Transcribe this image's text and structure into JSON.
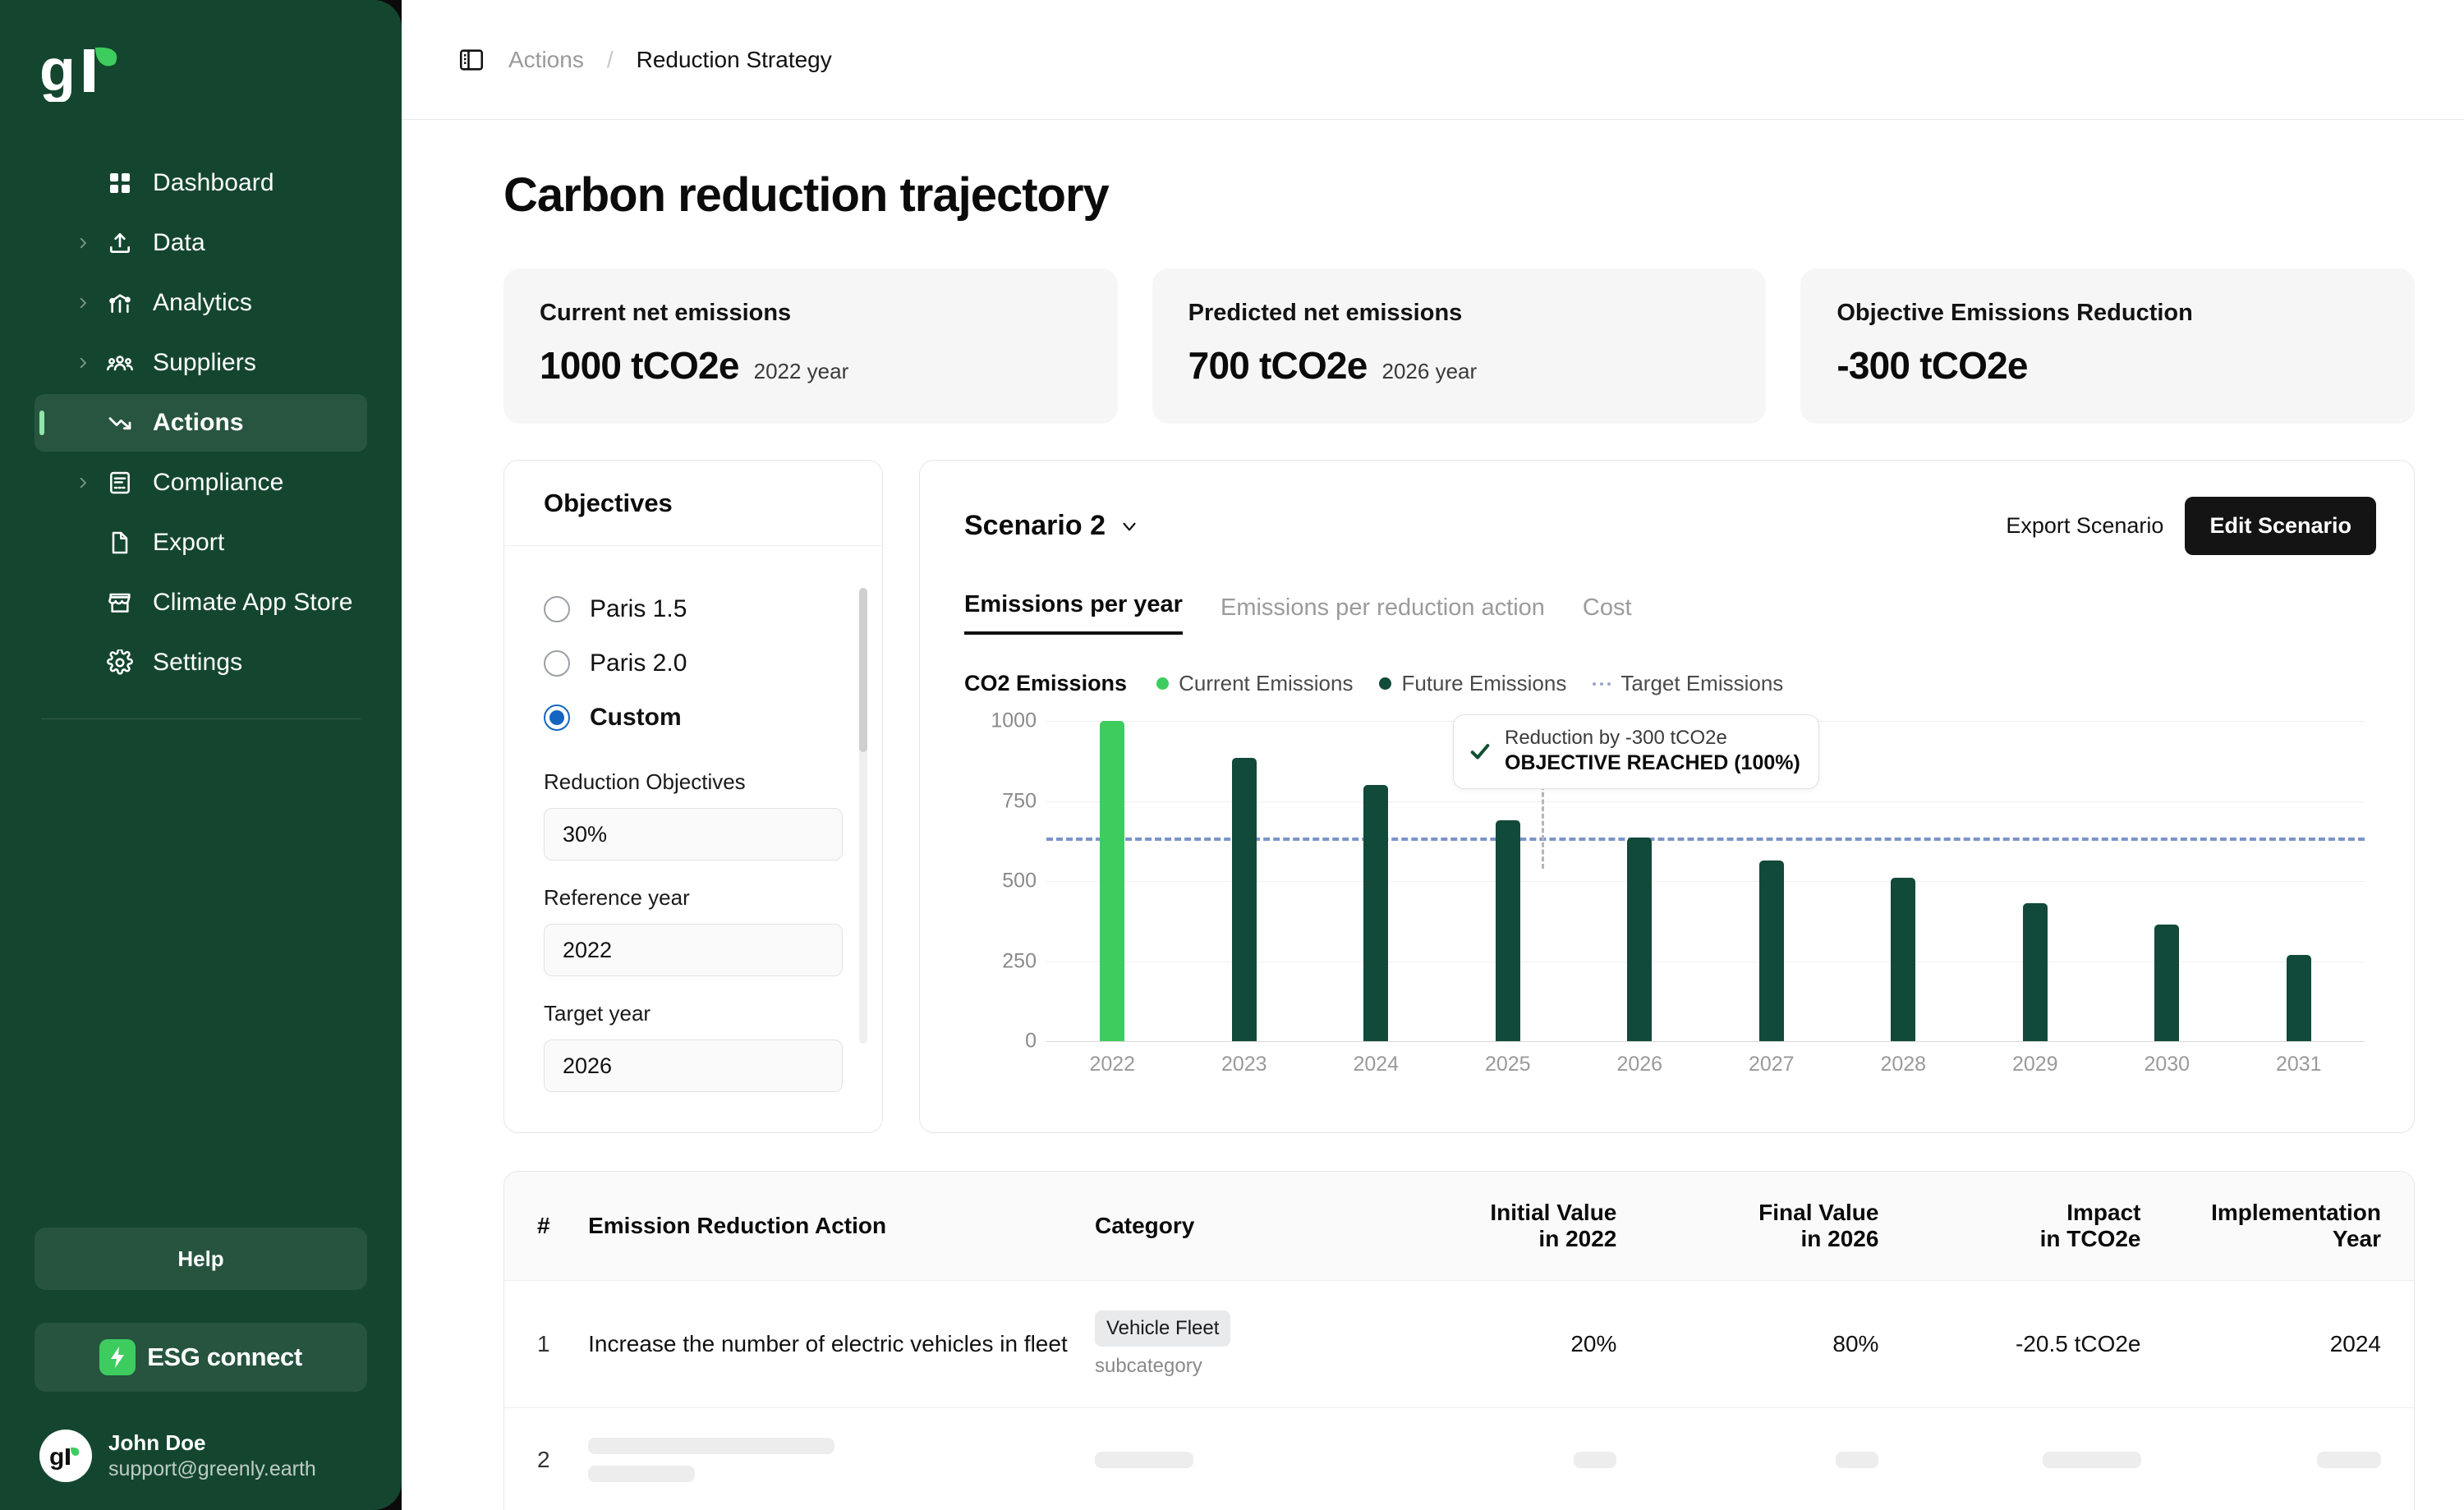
{
  "brand": {
    "logo_text": "gr",
    "accent": "#3ECC5F",
    "sidebar_bg": "#14462F",
    "dark_green": "#11493B"
  },
  "sidebar": {
    "items": [
      {
        "label": "Dashboard",
        "icon": "grid-icon",
        "expandable": false,
        "active": false
      },
      {
        "label": "Data",
        "icon": "upload-icon",
        "expandable": true,
        "active": false
      },
      {
        "label": "Analytics",
        "icon": "analytics-icon",
        "expandable": true,
        "active": false
      },
      {
        "label": "Suppliers",
        "icon": "people-icon",
        "expandable": true,
        "active": false
      },
      {
        "label": "Actions",
        "icon": "trend-down-icon",
        "expandable": false,
        "active": true
      },
      {
        "label": "Compliance",
        "icon": "document-list-icon",
        "expandable": true,
        "active": false
      },
      {
        "label": "Export",
        "icon": "file-icon",
        "expandable": false,
        "active": false
      },
      {
        "label": "Climate App Store",
        "icon": "store-icon",
        "expandable": false,
        "active": false
      },
      {
        "label": "Settings",
        "icon": "gear-icon",
        "expandable": false,
        "active": false
      }
    ],
    "help_label": "Help",
    "esg_label": "ESG connect",
    "user": {
      "name": "John Doe",
      "email": "support@greenly.earth"
    }
  },
  "topbar": {
    "breadcrumb_parent": "Actions",
    "breadcrumb_sep": "/",
    "breadcrumb_current": "Reduction Strategy"
  },
  "page": {
    "title": "Carbon reduction trajectory"
  },
  "kpis": [
    {
      "label": "Current net emissions",
      "value": "1000 tCO2e",
      "sub": "2022 year"
    },
    {
      "label": "Predicted net emissions",
      "value": "700 tCO2e",
      "sub": "2026 year"
    },
    {
      "label": "Objective Emissions Reduction",
      "value": "-300 tCO2e",
      "sub": ""
    }
  ],
  "objectives": {
    "title": "Objectives",
    "options": [
      {
        "label": "Paris 1.5",
        "selected": false
      },
      {
        "label": "Paris 2.0",
        "selected": false
      },
      {
        "label": "Custom",
        "selected": true
      }
    ],
    "fields": [
      {
        "label": "Reduction Objectives",
        "value": "30%"
      },
      {
        "label": "Reference year",
        "value": "2022"
      },
      {
        "label": "Target year",
        "value": "2026"
      }
    ]
  },
  "scenario": {
    "name": "Scenario 2",
    "export_label": "Export Scenario",
    "edit_label": "Edit Scenario",
    "tabs": [
      {
        "label": "Emissions per year",
        "active": true
      },
      {
        "label": "Emissions per reduction action",
        "active": false
      },
      {
        "label": "Cost",
        "active": false
      }
    ],
    "callout": {
      "line1": "Reduction by -300 tCO2e",
      "line2": "OBJECTIVE REACHED (100%)"
    }
  },
  "chart_data": {
    "type": "bar",
    "title": "CO2 Emissions",
    "xlabel": "",
    "ylabel": "",
    "ylim": [
      0,
      1000
    ],
    "yticks": [
      0,
      250,
      500,
      750,
      1000
    ],
    "grid": true,
    "legend_position": "top",
    "legend": [
      {
        "name": "Current Emissions",
        "color": "#3ECC5F",
        "marker": "dot"
      },
      {
        "name": "Future Emissions",
        "color": "#11493B",
        "marker": "dot"
      },
      {
        "name": "Target Emissions",
        "color": "#7D93C9",
        "marker": "dashed-line"
      }
    ],
    "categories": [
      "2022",
      "2023",
      "2024",
      "2025",
      "2026",
      "2027",
      "2028",
      "2029",
      "2030",
      "2031"
    ],
    "values": [
      1000,
      885,
      800,
      690,
      635,
      565,
      510,
      430,
      365,
      270
    ],
    "bar_colors": [
      "#3ECC5F",
      "#11493B",
      "#11493B",
      "#11493B",
      "#11493B",
      "#11493B",
      "#11493B",
      "#11493B",
      "#11493B",
      "#11493B"
    ],
    "target_line": {
      "value": 635,
      "label": "Target Emissions",
      "color": "#7D93C9",
      "style": "dashed"
    },
    "annotation": {
      "at_category": "2026",
      "line1": "Reduction by -300 tCO2e",
      "line2": "OBJECTIVE REACHED (100%)"
    }
  },
  "table": {
    "columns": [
      "#",
      "Emission Reduction Action",
      "Category",
      "Initial Value\nin 2022",
      "Final Value\nin 2026",
      "Impact\nin TCO2e",
      "Implementation\nYear"
    ],
    "columns_split": [
      {
        "l1": "#",
        "l2": ""
      },
      {
        "l1": "Emission Reduction Action",
        "l2": ""
      },
      {
        "l1": "Category",
        "l2": ""
      },
      {
        "l1": "Initial Value",
        "l2": "in 2022"
      },
      {
        "l1": "Final Value",
        "l2": "in 2026"
      },
      {
        "l1": "Impact",
        "l2": "in TCO2e"
      },
      {
        "l1": "Implementation",
        "l2": "Year"
      }
    ],
    "rows": [
      {
        "num": "1",
        "action": "Increase the number of electric vehicles in fleet",
        "category_chip": "Vehicle Fleet",
        "subcategory": "subcategory",
        "initial_value": "20%",
        "final_value": "80%",
        "impact": "-20.5 tCO2e",
        "implementation_year": "2024"
      },
      {
        "num": "2",
        "action": "",
        "category_chip": "",
        "subcategory": "",
        "initial_value": "",
        "final_value": "",
        "impact": "",
        "implementation_year": ""
      }
    ]
  }
}
